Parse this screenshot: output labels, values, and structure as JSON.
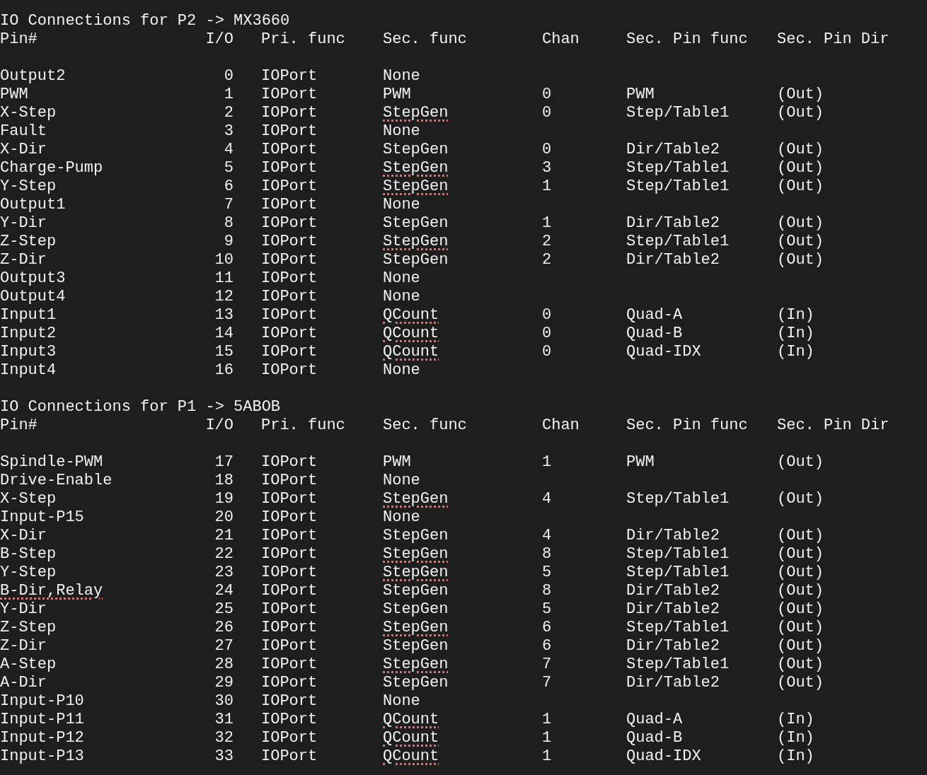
{
  "sections": [
    {
      "title": "IO Connections for P2 -> MX3660",
      "columns": [
        "Pin#",
        "I/O",
        "Pri. func",
        "Sec. func",
        "Chan",
        "Sec. Pin func",
        "Sec. Pin Dir"
      ],
      "rows": [
        {
          "pin": "Output2",
          "io": "0",
          "pri": "IOPort",
          "sec": "None",
          "pin_underlined": false,
          "sec_underlined": false
        },
        {
          "pin": "PWM",
          "io": "1",
          "pri": "IOPort",
          "sec": "PWM",
          "chan": "0",
          "sec_pin": "PWM",
          "dir": "(Out)",
          "pin_underlined": false,
          "sec_underlined": false
        },
        {
          "pin": "X-Step",
          "io": "2",
          "pri": "IOPort",
          "sec": "StepGen",
          "chan": "0",
          "sec_pin": "Step/Table1",
          "dir": "(Out)",
          "pin_underlined": false,
          "sec_underlined": true
        },
        {
          "pin": "Fault",
          "io": "3",
          "pri": "IOPort",
          "sec": "None",
          "pin_underlined": false,
          "sec_underlined": false
        },
        {
          "pin": "X-Dir",
          "io": "4",
          "pri": "IOPort",
          "sec": "StepGen",
          "chan": "0",
          "sec_pin": "Dir/Table2",
          "dir": "(Out)",
          "pin_underlined": false,
          "sec_underlined": false
        },
        {
          "pin": "Charge-Pump",
          "io": "5",
          "pri": "IOPort",
          "sec": "StepGen",
          "chan": "3",
          "sec_pin": "Step/Table1",
          "dir": "(Out)",
          "pin_underlined": false,
          "sec_underlined": true
        },
        {
          "pin": "Y-Step",
          "io": "6",
          "pri": "IOPort",
          "sec": "StepGen",
          "chan": "1",
          "sec_pin": "Step/Table1",
          "dir": "(Out)",
          "pin_underlined": false,
          "sec_underlined": true
        },
        {
          "pin": "Output1",
          "io": "7",
          "pri": "IOPort",
          "sec": "None",
          "pin_underlined": false,
          "sec_underlined": false
        },
        {
          "pin": "Y-Dir",
          "io": "8",
          "pri": "IOPort",
          "sec": "StepGen",
          "chan": "1",
          "sec_pin": "Dir/Table2",
          "dir": "(Out)",
          "pin_underlined": false,
          "sec_underlined": false
        },
        {
          "pin": "Z-Step",
          "io": "9",
          "pri": "IOPort",
          "sec": "StepGen",
          "chan": "2",
          "sec_pin": "Step/Table1",
          "dir": "(Out)",
          "pin_underlined": false,
          "sec_underlined": true
        },
        {
          "pin": "Z-Dir",
          "io": "10",
          "pri": "IOPort",
          "sec": "StepGen",
          "chan": "2",
          "sec_pin": "Dir/Table2",
          "dir": "(Out)",
          "pin_underlined": false,
          "sec_underlined": false
        },
        {
          "pin": "Output3",
          "io": "11",
          "pri": "IOPort",
          "sec": "None",
          "pin_underlined": false,
          "sec_underlined": false
        },
        {
          "pin": "Output4",
          "io": "12",
          "pri": "IOPort",
          "sec": "None",
          "pin_underlined": false,
          "sec_underlined": false
        },
        {
          "pin": "Input1",
          "io": "13",
          "pri": "IOPort",
          "sec": "QCount",
          "chan": "0",
          "sec_pin": "Quad-A",
          "dir": "(In)",
          "pin_underlined": false,
          "sec_underlined": true
        },
        {
          "pin": "Input2",
          "io": "14",
          "pri": "IOPort",
          "sec": "QCount",
          "chan": "0",
          "sec_pin": "Quad-B",
          "dir": "(In)",
          "pin_underlined": false,
          "sec_underlined": true
        },
        {
          "pin": "Input3",
          "io": "15",
          "pri": "IOPort",
          "sec": "QCount",
          "chan": "0",
          "sec_pin": "Quad-IDX",
          "dir": "(In)",
          "pin_underlined": false,
          "sec_underlined": true
        },
        {
          "pin": "Input4",
          "io": "16",
          "pri": "IOPort",
          "sec": "None",
          "pin_underlined": false,
          "sec_underlined": false
        }
      ]
    },
    {
      "title": "IO Connections for P1 -> 5ABOB",
      "columns": [
        "Pin#",
        "I/O",
        "Pri. func",
        "Sec. func",
        "Chan",
        "Sec. Pin func",
        "Sec. Pin Dir"
      ],
      "rows": [
        {
          "pin": "Spindle-PWM",
          "io": "17",
          "pri": "IOPort",
          "sec": "PWM",
          "chan": "1",
          "sec_pin": "PWM",
          "dir": "(Out)",
          "pin_underlined": false,
          "sec_underlined": false
        },
        {
          "pin": "Drive-Enable",
          "io": "18",
          "pri": "IOPort",
          "sec": "None",
          "pin_underlined": false,
          "sec_underlined": false
        },
        {
          "pin": "X-Step",
          "io": "19",
          "pri": "IOPort",
          "sec": "StepGen",
          "chan": "4",
          "sec_pin": "Step/Table1",
          "dir": "(Out)",
          "pin_underlined": false,
          "sec_underlined": true
        },
        {
          "pin": "Input-P15",
          "io": "20",
          "pri": "IOPort",
          "sec": "None",
          "pin_underlined": false,
          "sec_underlined": false
        },
        {
          "pin": "X-Dir",
          "io": "21",
          "pri": "IOPort",
          "sec": "StepGen",
          "chan": "4",
          "sec_pin": "Dir/Table2",
          "dir": "(Out)",
          "pin_underlined": false,
          "sec_underlined": false
        },
        {
          "pin": "B-Step",
          "io": "22",
          "pri": "IOPort",
          "sec": "StepGen",
          "chan": "8",
          "sec_pin": "Step/Table1",
          "dir": "(Out)",
          "pin_underlined": false,
          "sec_underlined": true
        },
        {
          "pin": "Y-Step",
          "io": "23",
          "pri": "IOPort",
          "sec": "StepGen",
          "chan": "5",
          "sec_pin": "Step/Table1",
          "dir": "(Out)",
          "pin_underlined": false,
          "sec_underlined": true
        },
        {
          "pin": "B-Dir,Relay",
          "io": "24",
          "pri": "IOPort",
          "sec": "StepGen",
          "chan": "8",
          "sec_pin": "Dir/Table2",
          "dir": "(Out)",
          "pin_underlined": true,
          "sec_underlined": false
        },
        {
          "pin": "Y-Dir",
          "io": "25",
          "pri": "IOPort",
          "sec": "StepGen",
          "chan": "5",
          "sec_pin": "Dir/Table2",
          "dir": "(Out)",
          "pin_underlined": false,
          "sec_underlined": false
        },
        {
          "pin": "Z-Step",
          "io": "26",
          "pri": "IOPort",
          "sec": "StepGen",
          "chan": "6",
          "sec_pin": "Step/Table1",
          "dir": "(Out)",
          "pin_underlined": false,
          "sec_underlined": true
        },
        {
          "pin": "Z-Dir",
          "io": "27",
          "pri": "IOPort",
          "sec": "StepGen",
          "chan": "6",
          "sec_pin": "Dir/Table2",
          "dir": "(Out)",
          "pin_underlined": false,
          "sec_underlined": false
        },
        {
          "pin": "A-Step",
          "io": "28",
          "pri": "IOPort",
          "sec": "StepGen",
          "chan": "7",
          "sec_pin": "Step/Table1",
          "dir": "(Out)",
          "pin_underlined": false,
          "sec_underlined": true
        },
        {
          "pin": "A-Dir",
          "io": "29",
          "pri": "IOPort",
          "sec": "StepGen",
          "chan": "7",
          "sec_pin": "Dir/Table2",
          "dir": "(Out)",
          "pin_underlined": false,
          "sec_underlined": false
        },
        {
          "pin": "Input-P10",
          "io": "30",
          "pri": "IOPort",
          "sec": "None",
          "pin_underlined": false,
          "sec_underlined": false
        },
        {
          "pin": "Input-P11",
          "io": "31",
          "pri": "IOPort",
          "sec": "QCount",
          "chan": "1",
          "sec_pin": "Quad-A",
          "dir": "(In)",
          "pin_underlined": false,
          "sec_underlined": true
        },
        {
          "pin": "Input-P12",
          "io": "32",
          "pri": "IOPort",
          "sec": "QCount",
          "chan": "1",
          "sec_pin": "Quad-B",
          "dir": "(In)",
          "pin_underlined": false,
          "sec_underlined": true
        },
        {
          "pin": "Input-P13",
          "io": "33",
          "pri": "IOPort",
          "sec": "QCount",
          "chan": "1",
          "sec_pin": "Quad-IDX",
          "dir": "(In)",
          "pin_underlined": false,
          "sec_underlined": true
        }
      ]
    }
  ]
}
